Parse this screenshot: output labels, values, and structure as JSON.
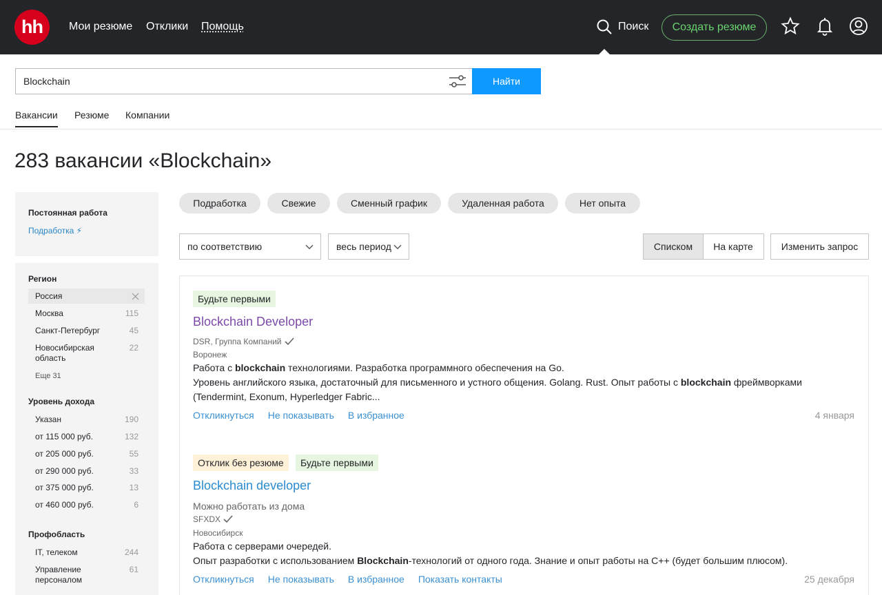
{
  "header": {
    "logo": "hh",
    "nav": [
      "Мои резюме",
      "Отклики",
      "Помощь"
    ],
    "search_label": "Поиск",
    "create_resume": "Создать резюме"
  },
  "search": {
    "query": "Blockchain",
    "button": "Найти",
    "tabs": [
      "Вакансии",
      "Резюме",
      "Компании"
    ]
  },
  "page_title": "283 вакансии «Blockchain»",
  "sidebar": {
    "employment_title": "Постоянная работа",
    "employment_link": "Подработка ⚡",
    "region_title": "Регион",
    "region_items": [
      {
        "label": "Россия",
        "count": ""
      },
      {
        "label": "Москва",
        "count": "115"
      },
      {
        "label": "Санкт-Петербург",
        "count": "45"
      },
      {
        "label": "Новосибирская область",
        "count": "22"
      }
    ],
    "region_more": "Еще 31",
    "income_title": "Уровень дохода",
    "income_items": [
      {
        "label": "Указан",
        "count": "190"
      },
      {
        "label": "от 115 000 руб.",
        "count": "132"
      },
      {
        "label": "от 205 000 руб.",
        "count": "55"
      },
      {
        "label": "от 290 000 руб.",
        "count": "33"
      },
      {
        "label": "от 375 000 руб.",
        "count": "13"
      },
      {
        "label": "от 460 000 руб.",
        "count": "6"
      }
    ],
    "prof_title": "Профобласть",
    "prof_items": [
      {
        "label": "IT, телеком",
        "count": "244"
      },
      {
        "label": "Управление персоналом",
        "count": "61"
      }
    ]
  },
  "chips": [
    "Подработка",
    "Свежие",
    "Сменный график",
    "Удаленная работа",
    "Нет опыта"
  ],
  "sort": {
    "order": "по соответствию",
    "period": "весь период",
    "view_list": "Списком",
    "view_map": "На карте",
    "change_query": "Изменить запрос"
  },
  "vacancies": [
    {
      "badges": [
        "Будьте первыми"
      ],
      "title": "Blockchain Developer",
      "remote": "",
      "company": "DSR, Группа Компаний",
      "city": "Воронеж",
      "desc_line1": [
        "Работа с ",
        "blockchain",
        " технологиями. Разработка программного обеспечения на Go."
      ],
      "desc_line2": [
        "Уровень английского языка, достаточный для письменного и устного общения. Golang. Rust. Опыт работы с ",
        "blockchain",
        " фреймворками (Tendermint, Exonum, Hyperledger Fabric..."
      ],
      "actions": [
        "Откликнуться",
        "Не показывать",
        "В избранное"
      ],
      "date": "4 января"
    },
    {
      "badges": [
        "Отклик без резюме",
        "Будьте первыми"
      ],
      "title": "Blockchain developer",
      "remote": "Можно работать из дома",
      "company": "SFXDX",
      "city": "Новосибирск",
      "desc_line1": [
        "Работа с серверами очередей.",
        "",
        ""
      ],
      "desc_line2": [
        "Опыт разработки с использованием ",
        "Blockchain",
        "-технологий от одного года. Знание и опыт работы на C++ (будет большим плюсом)."
      ],
      "actions": [
        "Откликнуться",
        "Не показывать",
        "В избранное",
        "Показать контакты"
      ],
      "date": "25 декабря"
    }
  ],
  "colors": {
    "header_bg": "#232529",
    "accent_blue": "#0d99ff",
    "create_green": "#6ad36e",
    "link_blue": "#3a8fd0",
    "visited_purple": "#7b4aa8",
    "title_blue": "#2a8bd0"
  }
}
